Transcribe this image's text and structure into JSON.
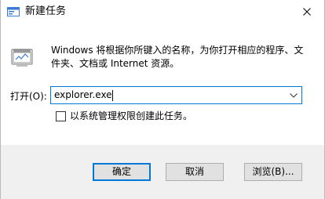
{
  "window": {
    "title": "新建任务",
    "title_icon": "run-dialog-icon",
    "close_icon": "close-icon"
  },
  "body": {
    "app_icon": "run-program-icon",
    "description": "Windows 将根据你所键入的名称，为你打开相应的程序、文件夹、文档或 Internet 资源。",
    "open_label": "打开(O):",
    "open_value": "explorer.exe",
    "dropdown_icon": "chevron-down-icon",
    "admin_checkbox_label": "以系统管理权限创建此任务。",
    "admin_checked": false
  },
  "buttons": {
    "ok": "确定",
    "cancel": "取消",
    "browse": "浏览(B)..."
  },
  "colors": {
    "accent": "#0078d7",
    "footer_bg": "#f0f0f0",
    "button_bg": "#e1e1e1"
  }
}
